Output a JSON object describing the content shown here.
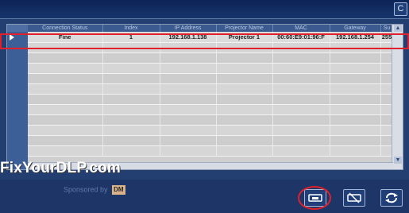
{
  "window": {
    "title_control": "C"
  },
  "grid": {
    "columns": [
      "Connection Status",
      "Index",
      "IP Address",
      "Projector Name",
      "MAC",
      "Gateway",
      "Su"
    ],
    "rows": [
      [
        "Fine",
        "1",
        "192.168.1.138",
        "Projector 1",
        "00:60:E9:01:96:F",
        "192.168.1.254",
        "255"
      ]
    ],
    "empty_row_count": 11
  },
  "watermark": "FixYourDLP.com",
  "sponsor": {
    "label": "Sponsored by",
    "logo": "DM"
  },
  "toolbar": {
    "buttons": [
      "projector-connect-icon",
      "projector-disconnect-icon",
      "refresh-icon"
    ]
  },
  "colors": {
    "highlight": "#e0202a",
    "window_bg": "#233f72"
  }
}
